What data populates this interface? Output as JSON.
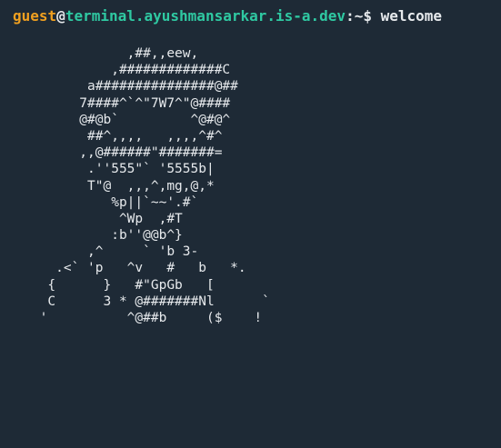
{
  "prompt": {
    "user": "guest",
    "at": "@",
    "host": "terminal.ayushmansarkar.is-a.dev",
    "separator": ":~$",
    "command": "welcome"
  },
  "ascii_art": [
    "                ,##,,eew,",
    "              ,#############C",
    "           a###############@##",
    "          7####^`^\"7W7^\"@####",
    "          @#@b`         ^@#@^",
    "           ##^,,,,   ,,,,^#^",
    "          ,,@######\"#######=",
    "           .''555\"` '5555b|",
    "           T\"@  ,,,^,mg,@,*",
    "              %p||`~~'.#`",
    "               ^Wp  ,#T",
    "              :b''@@b^}",
    "           ,^     ` 'b 3-",
    "       .<` 'p   ^v   #   b   *.",
    "      {      }   #\"GpGb   [",
    "      C      3 * @#######Nl      `",
    "     '          ^@##b     ($    !"
  ],
  "colors": {
    "background": "#1e2a36",
    "user": "#f0a020",
    "host": "#2fc9a2",
    "text": "#e6e9ec"
  }
}
